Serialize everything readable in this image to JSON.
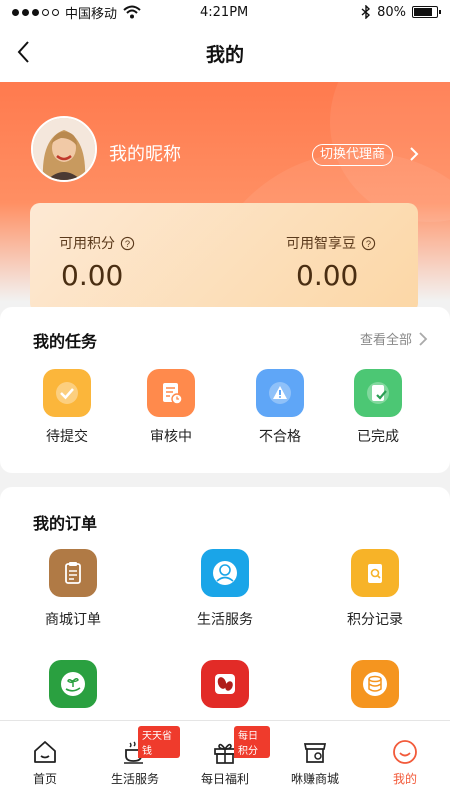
{
  "status": {
    "carrier": "中国移动",
    "time": "4:21PM",
    "battery": "80%",
    "battery_level": 0.8
  },
  "nav": {
    "title": "我的"
  },
  "profile": {
    "nickname": "我的昵称",
    "switch_label": "切换代理商"
  },
  "points": {
    "available_label": "可用积分",
    "available_value": "0.00",
    "beans_label": "可用智享豆",
    "beans_value": "0.00"
  },
  "tasks": {
    "title": "我的任务",
    "view_all": "查看全部",
    "items": [
      {
        "label": "待提交",
        "icon": "check-icon",
        "color": "#fbb63b"
      },
      {
        "label": "审核中",
        "icon": "document-clock-icon",
        "color": "#ff8a4c"
      },
      {
        "label": "不合格",
        "icon": "warning-icon",
        "color": "#5fa6f7"
      },
      {
        "label": "已完成",
        "icon": "completed-doc-icon",
        "color": "#4cc774"
      }
    ]
  },
  "orders": {
    "title": "我的订单",
    "items": [
      {
        "label": "商城订单",
        "icon": "clipboard-icon",
        "color": "#b07a45"
      },
      {
        "label": "生活服务",
        "icon": "person-service-icon",
        "color": "#1aa5e8"
      },
      {
        "label": "积分记录",
        "icon": "search-record-icon",
        "color": "#f7b328"
      },
      {
        "label": "",
        "icon": "plant-hand-icon",
        "color": "#2aa040"
      },
      {
        "label": "",
        "icon": "beans-icon",
        "color": "#e22b27"
      },
      {
        "label": "",
        "icon": "coin-stack-icon",
        "color": "#f5951f"
      }
    ]
  },
  "tabbar": {
    "items": [
      {
        "label": "首页",
        "icon": "home-icon",
        "badge": ""
      },
      {
        "label": "生活服务",
        "icon": "coffee-icon",
        "badge": "天天省钱"
      },
      {
        "label": "每日福利",
        "icon": "gift-icon",
        "badge": "每日积分"
      },
      {
        "label": "咻赚商城",
        "icon": "store-icon",
        "badge": ""
      },
      {
        "label": "我的",
        "icon": "smile-icon",
        "badge": ""
      }
    ],
    "active_color": "#f25a3a"
  }
}
